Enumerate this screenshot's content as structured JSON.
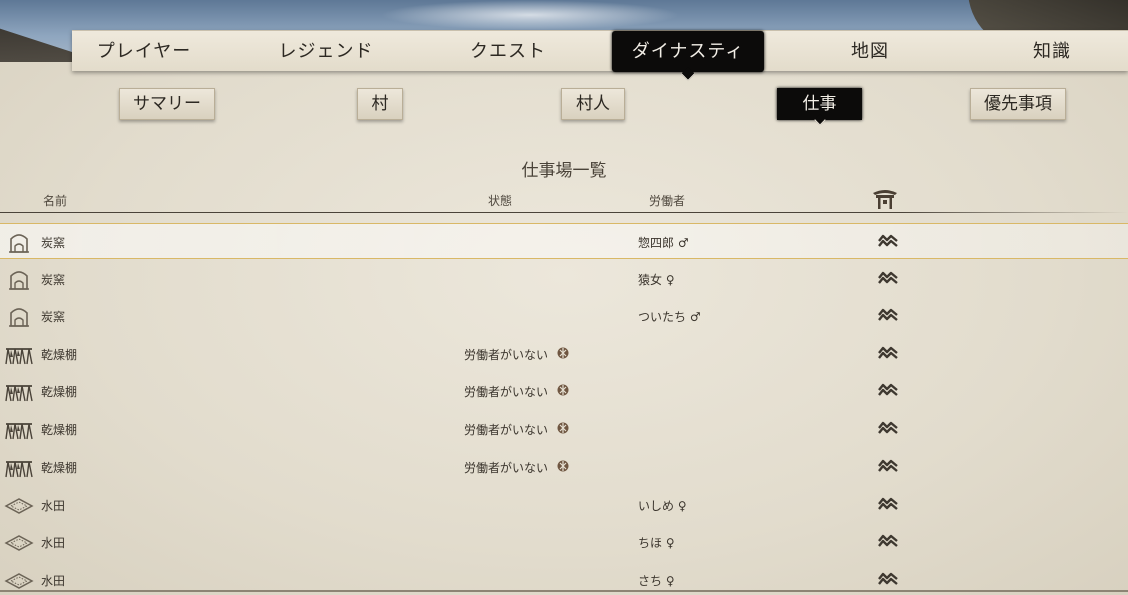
{
  "main_tabs": [
    "プレイヤー",
    "レジェンド",
    "クエスト",
    "ダイナスティ",
    "地図",
    "知識"
  ],
  "main_tab_active": "ダイナスティ",
  "sub_tabs": [
    "サマリー",
    "村",
    "村人",
    "仕事",
    "優先事項"
  ],
  "sub_tab_active": "仕事",
  "section_title": "仕事場一覧",
  "columns": {
    "name": "名前",
    "status": "状態",
    "worker": "労働者",
    "priority_icon": "shrine-icon"
  },
  "rows": [
    {
      "icon": "kiln-icon",
      "name": "炭窯",
      "status": "",
      "worker": "惣四郎 ♂",
      "priority": "high",
      "selected": true
    },
    {
      "icon": "kiln-icon",
      "name": "炭窯",
      "status": "",
      "worker": "猿女 ♀",
      "priority": "high",
      "selected": false
    },
    {
      "icon": "kiln-icon",
      "name": "炭窯",
      "status": "",
      "worker": "ついたち ♂",
      "priority": "high",
      "selected": false
    },
    {
      "icon": "drying-rack-icon",
      "name": "乾燥棚",
      "status": "労働者がいない",
      "worker": "",
      "priority": "high",
      "selected": false
    },
    {
      "icon": "drying-rack-icon",
      "name": "乾燥棚",
      "status": "労働者がいない",
      "worker": "",
      "priority": "high",
      "selected": false
    },
    {
      "icon": "drying-rack-icon",
      "name": "乾燥棚",
      "status": "労働者がいない",
      "worker": "",
      "priority": "high",
      "selected": false
    },
    {
      "icon": "drying-rack-icon",
      "name": "乾燥棚",
      "status": "労働者がいない",
      "worker": "",
      "priority": "high",
      "selected": false
    },
    {
      "icon": "rice-paddy-icon",
      "name": "水田",
      "status": "",
      "worker": "いしめ ♀",
      "priority": "high",
      "selected": false
    },
    {
      "icon": "rice-paddy-icon",
      "name": "水田",
      "status": "",
      "worker": "ちほ ♀",
      "priority": "high",
      "selected": false
    },
    {
      "icon": "rice-paddy-icon",
      "name": "水田",
      "status": "",
      "worker": "さち ♀",
      "priority": "high",
      "selected": false
    }
  ],
  "colors": {
    "active_tab_bg": "#0c0b0a",
    "parchment": "#e6e0d2",
    "selected_border": "#d9b866",
    "text": "#3b352d"
  }
}
